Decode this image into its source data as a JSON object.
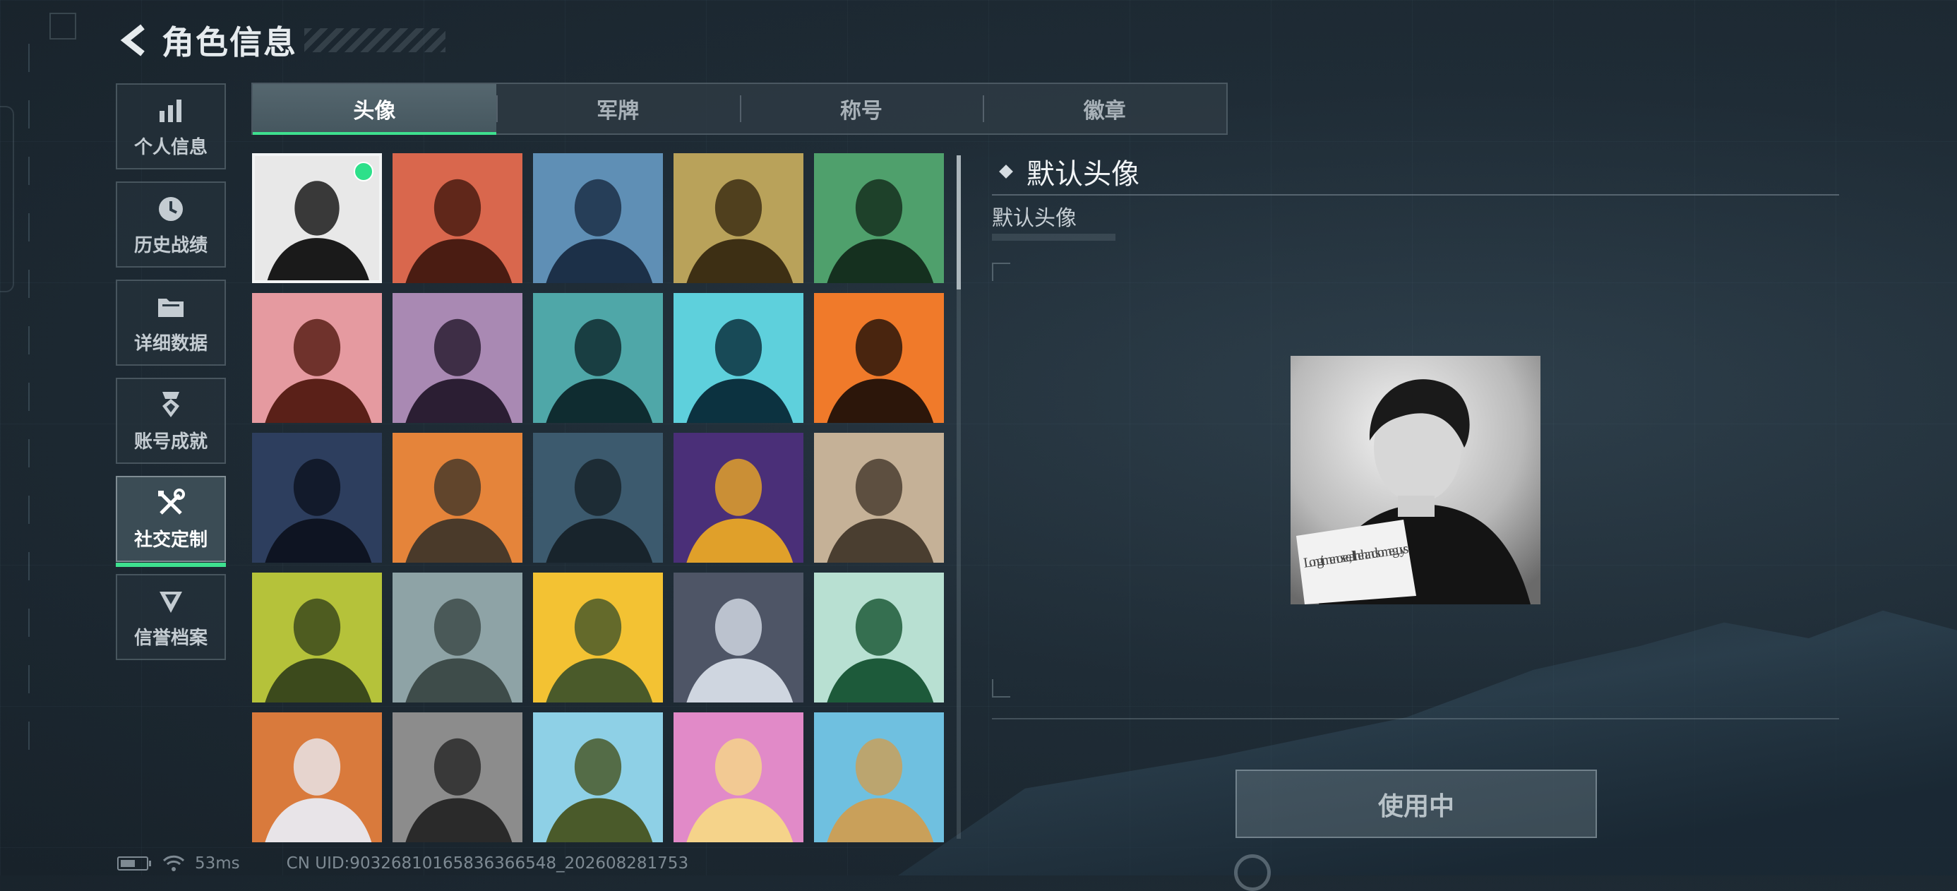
{
  "header": {
    "title": "角色信息"
  },
  "sidebar": {
    "items": [
      {
        "label": "个人信息",
        "icon": "bar-chart-icon"
      },
      {
        "label": "历史战绩",
        "icon": "history-clock-icon"
      },
      {
        "label": "详细数据",
        "icon": "folder-icon"
      },
      {
        "label": "账号成就",
        "icon": "achievement-medal-icon"
      },
      {
        "label": "社交定制",
        "icon": "wrench-screwdriver-icon",
        "active": true
      },
      {
        "label": "信誉档案",
        "icon": "shield-badge-icon"
      }
    ]
  },
  "tabs": [
    {
      "label": "头像",
      "active": true
    },
    {
      "label": "军牌"
    },
    {
      "label": "称号"
    },
    {
      "label": "徽章"
    }
  ],
  "grid": {
    "selected_index": 0,
    "avatars": [
      {
        "name": "default-avatar",
        "colors": [
          "#e8e8e8",
          "#1a1a1a"
        ]
      },
      {
        "name": "bearded-operator-red",
        "colors": [
          "#d9674d",
          "#4a1c12"
        ]
      },
      {
        "name": "pilot-woman-blue",
        "colors": [
          "#5f8fb5",
          "#1c3048"
        ]
      },
      {
        "name": "bald-operator-gold",
        "colors": [
          "#b9a25a",
          "#3d2f14"
        ]
      },
      {
        "name": "operator-green",
        "colors": [
          "#4fa06c",
          "#15301f"
        ]
      },
      {
        "name": "helmet-woman-pink",
        "colors": [
          "#e59aa0",
          "#5a2018"
        ]
      },
      {
        "name": "white-hair-woman-purple",
        "colors": [
          "#a989b3",
          "#2b1e33"
        ]
      },
      {
        "name": "bearded-glasses-teal",
        "colors": [
          "#4fa7a8",
          "#0f2c30"
        ]
      },
      {
        "name": "masked-helmet-cyan",
        "colors": [
          "#5ed0dc",
          "#0c3240"
        ]
      },
      {
        "name": "masked-operator-orange",
        "colors": [
          "#f07a2a",
          "#2c160a"
        ]
      },
      {
        "name": "night-soldier",
        "colors": [
          "#2d3e5e",
          "#0e1422"
        ]
      },
      {
        "name": "heavy-gunner-orange",
        "colors": [
          "#e5843a",
          "#4a3a2a"
        ]
      },
      {
        "name": "scope-rifle",
        "colors": [
          "#3c5a6e",
          "#18242c"
        ]
      },
      {
        "name": "card-pack-purple",
        "colors": [
          "#4a2f78",
          "#e0a02a"
        ]
      },
      {
        "name": "desert-helicopter",
        "colors": [
          "#c5b197",
          "#4a3e30"
        ]
      },
      {
        "name": "exit-door-green",
        "colors": [
          "#b5c23a",
          "#3c4a1c"
        ]
      },
      {
        "name": "helicopter-field",
        "colors": [
          "#8ea3a6",
          "#3e4c4a"
        ]
      },
      {
        "name": "cartoon-soldier-eating",
        "colors": [
          "#f3c233",
          "#4a5a2a"
        ]
      },
      {
        "name": "anime-girl-goggles",
        "colors": [
          "#4e5566",
          "#cfd6e0"
        ]
      },
      {
        "name": "way-out-sign",
        "colors": [
          "#b8e0d2",
          "#1d5a3a"
        ]
      },
      {
        "name": "hand-diamond",
        "colors": [
          "#d97a3c",
          "#e8e4e8"
        ]
      },
      {
        "name": "smoke-soldier",
        "colors": [
          "#8c8c8c",
          "#2a2a2a"
        ]
      },
      {
        "name": "cartoon-soldier-wink",
        "colors": [
          "#8ed0e6",
          "#4a5a2a"
        ]
      },
      {
        "name": "cartoon-girl-tongue",
        "colors": [
          "#e18ac8",
          "#f5d38a"
        ]
      },
      {
        "name": "palace-building",
        "colors": [
          "#6fc0e0",
          "#c9a05a"
        ]
      }
    ]
  },
  "detail": {
    "title": "默认头像",
    "subtitle": "默认头像",
    "preview_note": "Long time no see, all the handsome guys",
    "action_label": "使用中"
  },
  "status_bar": {
    "ping": "53ms",
    "uid": "CN UID:903268101658363665​48_202608281753"
  },
  "colors": {
    "accent": "#3ee08f",
    "bg": "#1f2c36"
  }
}
